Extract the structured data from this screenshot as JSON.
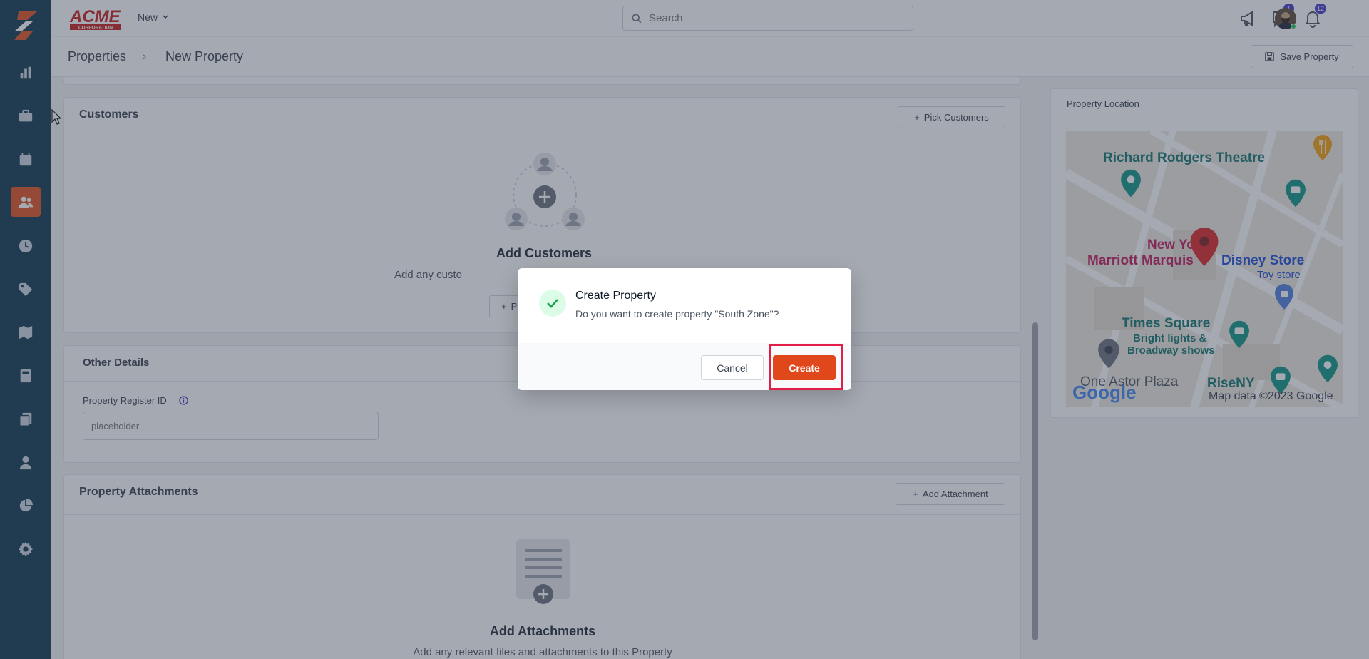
{
  "app": {
    "brand": "ACME CORPORATION",
    "new_menu_label": "New"
  },
  "search": {
    "placeholder": "Search"
  },
  "header_icons": {
    "messages_badge": "1",
    "notifications_badge": "12"
  },
  "breadcrumb": {
    "parent": "Properties",
    "separator": "›",
    "current": "New Property"
  },
  "toolbar": {
    "save_label": "Save Property"
  },
  "sidebar": {
    "items": [
      {
        "name": "reports",
        "icon": "bar-chart-icon"
      },
      {
        "name": "jobs",
        "icon": "briefcase-icon"
      },
      {
        "name": "calendar",
        "icon": "calendar-icon"
      },
      {
        "name": "customers",
        "icon": "users-icon",
        "active": true
      },
      {
        "name": "time",
        "icon": "clock-icon"
      },
      {
        "name": "tags",
        "icon": "tag-icon"
      },
      {
        "name": "map",
        "icon": "map-icon"
      },
      {
        "name": "calculator",
        "icon": "calculator-icon"
      },
      {
        "name": "documents",
        "icon": "documents-icon"
      },
      {
        "name": "user",
        "icon": "user-icon"
      },
      {
        "name": "analytics",
        "icon": "pie-chart-icon"
      },
      {
        "name": "settings",
        "icon": "gear-icon"
      }
    ]
  },
  "customers": {
    "title": "Customers",
    "pick_label": "Pick Customers",
    "empty_title": "Add Customers",
    "empty_text": "Add any custo",
    "button_partial": "P"
  },
  "other_details": {
    "title": "Other Details",
    "register_label": "Property Register ID",
    "register_placeholder": "placeholder"
  },
  "attachments": {
    "title": "Property Attachments",
    "add_label": "Add Attachment",
    "empty_title": "Add Attachments",
    "empty_text": "Add any relevant files and attachments to this Property"
  },
  "location": {
    "title": "Property Location",
    "map_labels": {
      "theatre": "Richard Rodgers Theatre",
      "marriott_1": "New York",
      "marriott_2": "Marriott Marquis",
      "disney": "Disney Store",
      "toy": "Toy store",
      "times_square": "Times Square",
      "bright_1": "Bright lights &",
      "bright_2": "Broadway shows",
      "astor": "One Astor Plaza",
      "rise": "RiseNY",
      "google": "Google",
      "map_data": "Map data ©2023 Google"
    }
  },
  "modal": {
    "title": "Create Property",
    "text": "Do you want to create property \"South Zone\"?",
    "cancel_label": "Cancel",
    "create_label": "Create"
  },
  "colors": {
    "accent": "#e0481c",
    "sidebar": "#0f3a4f",
    "highlight": "#e11d48"
  }
}
